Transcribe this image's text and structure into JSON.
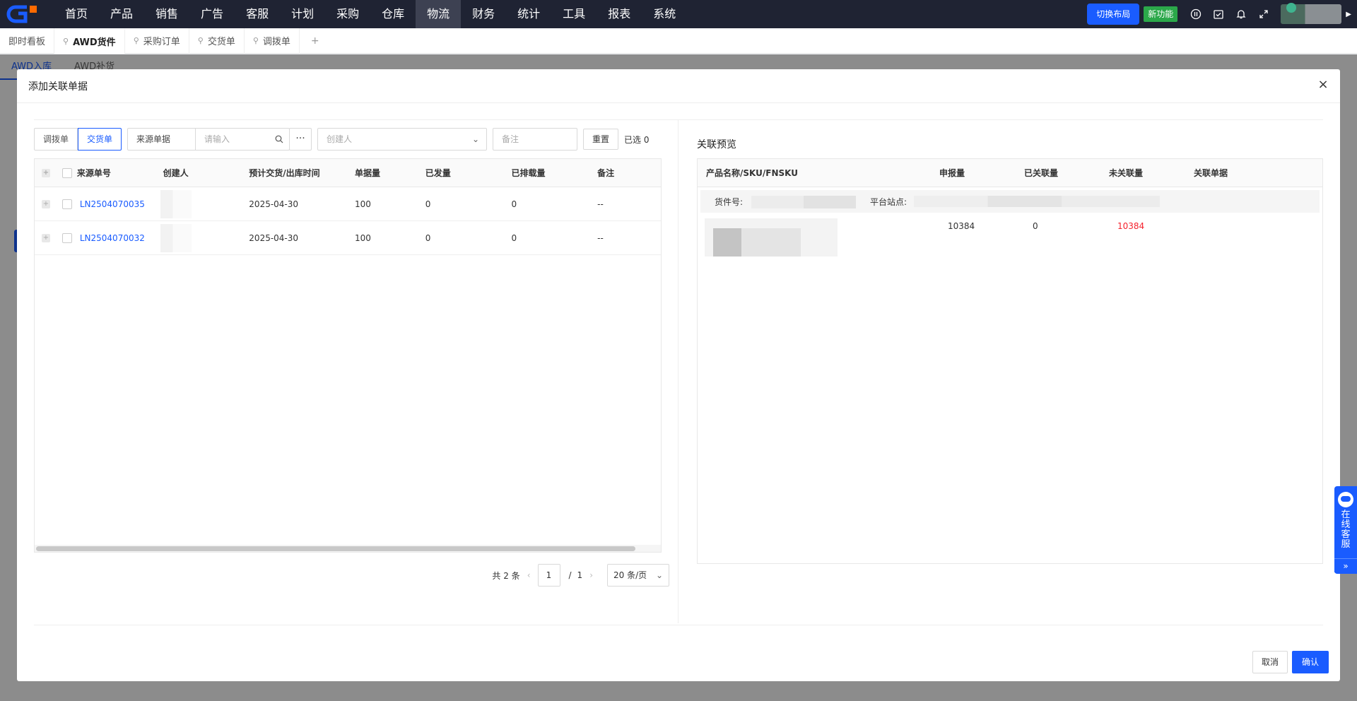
{
  "nav": {
    "items": [
      "首页",
      "产品",
      "销售",
      "广告",
      "客服",
      "计划",
      "采购",
      "仓库",
      "物流",
      "财务",
      "统计",
      "工具",
      "报表",
      "系统"
    ],
    "active_index": 8,
    "switch_layout": "切换布局",
    "new_feature": "新功能"
  },
  "tabs": {
    "items": [
      {
        "label": "即时看板",
        "pinned": false
      },
      {
        "label": "AWD货件",
        "pinned": true
      },
      {
        "label": "采购订单",
        "pinned": true
      },
      {
        "label": "交货单",
        "pinned": true
      },
      {
        "label": "调拨单",
        "pinned": true
      }
    ],
    "active_index": 1,
    "add": "+"
  },
  "subtabs": [
    "AWD入库",
    "AWD补货"
  ],
  "modal": {
    "title": "添加关联单据",
    "close": "×",
    "filters": {
      "type_options": [
        "调拨单",
        "交货单"
      ],
      "type_active": 1,
      "source_select": "来源单据",
      "source_placeholder": "请输入",
      "more": "···",
      "creator_placeholder": "创建人",
      "remark_placeholder": "备注",
      "reset": "重置",
      "selected": "已选 0"
    },
    "table": {
      "columns": [
        "来源单号",
        "创建人",
        "预计交货/出库时间",
        "单据量",
        "已发量",
        "已排载量",
        "备注"
      ],
      "rows": [
        {
          "no": "LN2504070035",
          "time": "2025-04-30",
          "qty": "100",
          "sent": "0",
          "scheduled": "0",
          "remark": "--"
        },
        {
          "no": "LN2504070032",
          "time": "2025-04-30",
          "qty": "100",
          "sent": "0",
          "scheduled": "0",
          "remark": "--"
        }
      ]
    },
    "pager": {
      "total": "共 2 条",
      "page": "1",
      "sep": "/",
      "pages": "1",
      "size": "20 条/页"
    },
    "preview": {
      "title": "关联预览",
      "columns": [
        "产品名称/SKU/FNSKU",
        "申报量",
        "已关联量",
        "未关联量",
        "关联单据"
      ],
      "group_label1": "货件号:",
      "group_label2": "平台站点:",
      "row": {
        "req": "10384",
        "rel": "0",
        "unrel": "10384"
      }
    },
    "cancel": "取消",
    "ok": "确认"
  },
  "service": {
    "text": "在线客服",
    "more": "»"
  },
  "colors": {
    "primary": "#1a5cff",
    "nav_bg": "#1f2333",
    "success": "#2ba84a",
    "danger": "#f5222d"
  }
}
